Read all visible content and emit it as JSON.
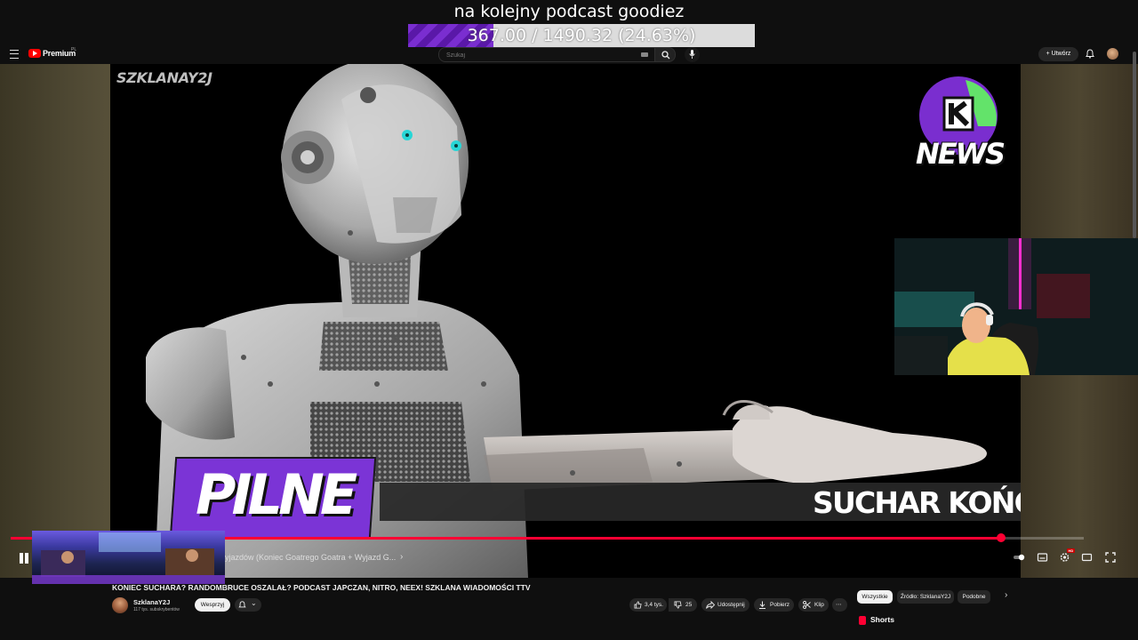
{
  "overlay": {
    "stream_title": "na kolejny podcast goodiez",
    "goal_text": "367.00 / 1490.32 (24.63%)",
    "goal_progress": 0.2463
  },
  "topbar": {
    "brand": "Premium",
    "region": "PL",
    "search_placeholder": "Szukaj",
    "create_label": "Utwórz"
  },
  "video": {
    "watermark": "SZKLANAY2J",
    "news_label": "NEWS",
    "breaking_label": "PILNE",
    "ticker_text": "SUCHAR KOŃCZY"
  },
  "player": {
    "progress": 0.923,
    "chapter_title": "yjazdów (Koniec Goatrego Goatra + Wyjazd G...",
    "hd_badge": "HD"
  },
  "meta": {
    "video_title": "KONIEC SUCHARA? RANDOMBRUCE OSZALAŁ? PODCAST JAPCZAN, NITRO, NEEX! SZKLANA WIADOMOŚCI TTV",
    "channel_name": "SzklanaY2J",
    "subscribers": "117 tys. subskrybentów",
    "support_label": "Wesprzyj",
    "likes": "3,4 tys.",
    "dislikes": "25",
    "share_label": "Udostępnij",
    "download_label": "Pobierz",
    "clip_label": "Klip"
  },
  "chips": [
    "Wszystkie",
    "Źródło: SzklanaY2J",
    "Podobne"
  ],
  "shelf": {
    "shorts_label": "Shorts"
  },
  "colors": {
    "accent_red": "#ff0033",
    "purple": "#7b34d6",
    "green": "#63e36a"
  }
}
